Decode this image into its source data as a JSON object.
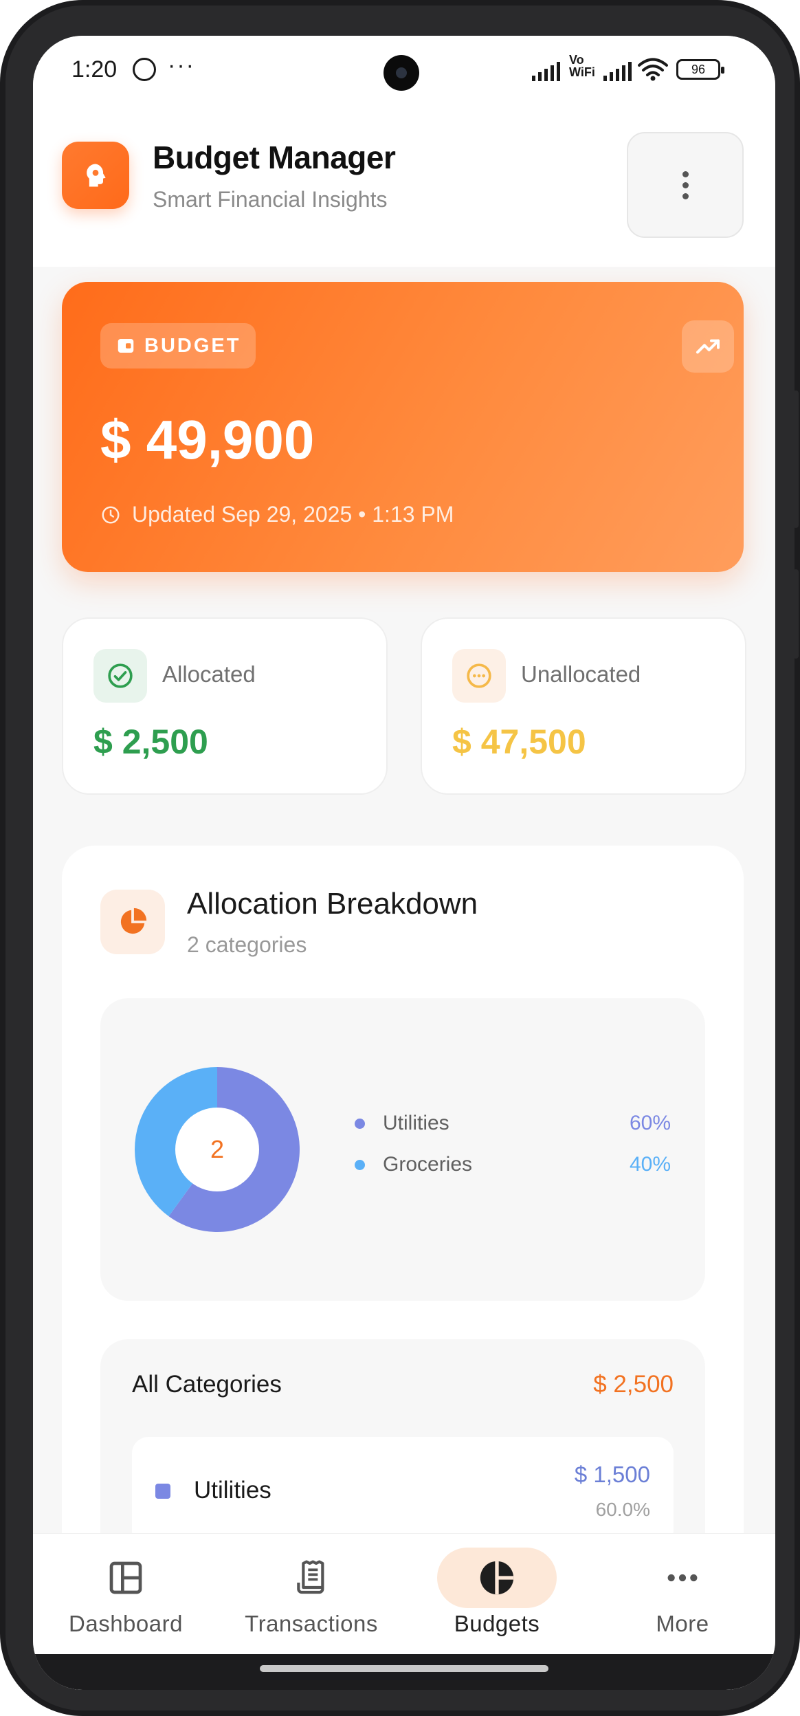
{
  "status_bar": {
    "time": "1:20",
    "more_dots": "···",
    "vowifi_line1": "Vo",
    "vowifi_line2": "WiFi",
    "battery": "96"
  },
  "header": {
    "title": "Budget Manager",
    "subtitle": "Smart Financial Insights",
    "logo_icon": "brain-head-icon",
    "menu_icon": "more-vertical-icon"
  },
  "budget_card": {
    "badge_label": "BUDGET",
    "amount": "$ 49,900",
    "updated": "Updated Sep 29, 2025 • 1:13 PM",
    "colors": {
      "gradient_start": "#ff6c1a",
      "gradient_end": "#ff9d5c"
    }
  },
  "stats": {
    "allocated": {
      "label": "Allocated",
      "value": "$ 2,500",
      "color": "#2e9e4f",
      "icon": "check-circle-icon"
    },
    "unallocated": {
      "label": "Unallocated",
      "value": "$ 47,500",
      "color": "#f5c445",
      "icon": "more-horizontal-circle-icon"
    }
  },
  "breakdown": {
    "title": "Allocation Breakdown",
    "subtitle": "2 categories",
    "donut_center": "2",
    "legend": [
      {
        "name": "Utilities",
        "pct": "60%",
        "color": "#7b88e3"
      },
      {
        "name": "Groceries",
        "pct": "40%",
        "color": "#5ab0f7"
      }
    ],
    "all_categories_title": "All Categories",
    "all_categories_total": "$ 2,500",
    "items": [
      {
        "name": "Utilities",
        "amount": "$ 1,500",
        "pct": "60.0%"
      }
    ]
  },
  "chart_data": {
    "type": "pie",
    "categories": [
      "Utilities",
      "Groceries"
    ],
    "values": [
      60,
      40
    ],
    "colors": [
      "#7b88e3",
      "#5ab0f7"
    ],
    "title": ""
  },
  "bottom_nav": [
    {
      "label": "Dashboard",
      "icon": "dashboard-icon",
      "active": false
    },
    {
      "label": "Transactions",
      "icon": "receipt-icon",
      "active": false
    },
    {
      "label": "Budgets",
      "icon": "pie-chart-icon",
      "active": true
    },
    {
      "label": "More",
      "icon": "more-horizontal-icon",
      "active": false
    }
  ],
  "colors": {
    "accent": "#ff6c1a",
    "active_nav_bg": "#fde8d8"
  }
}
